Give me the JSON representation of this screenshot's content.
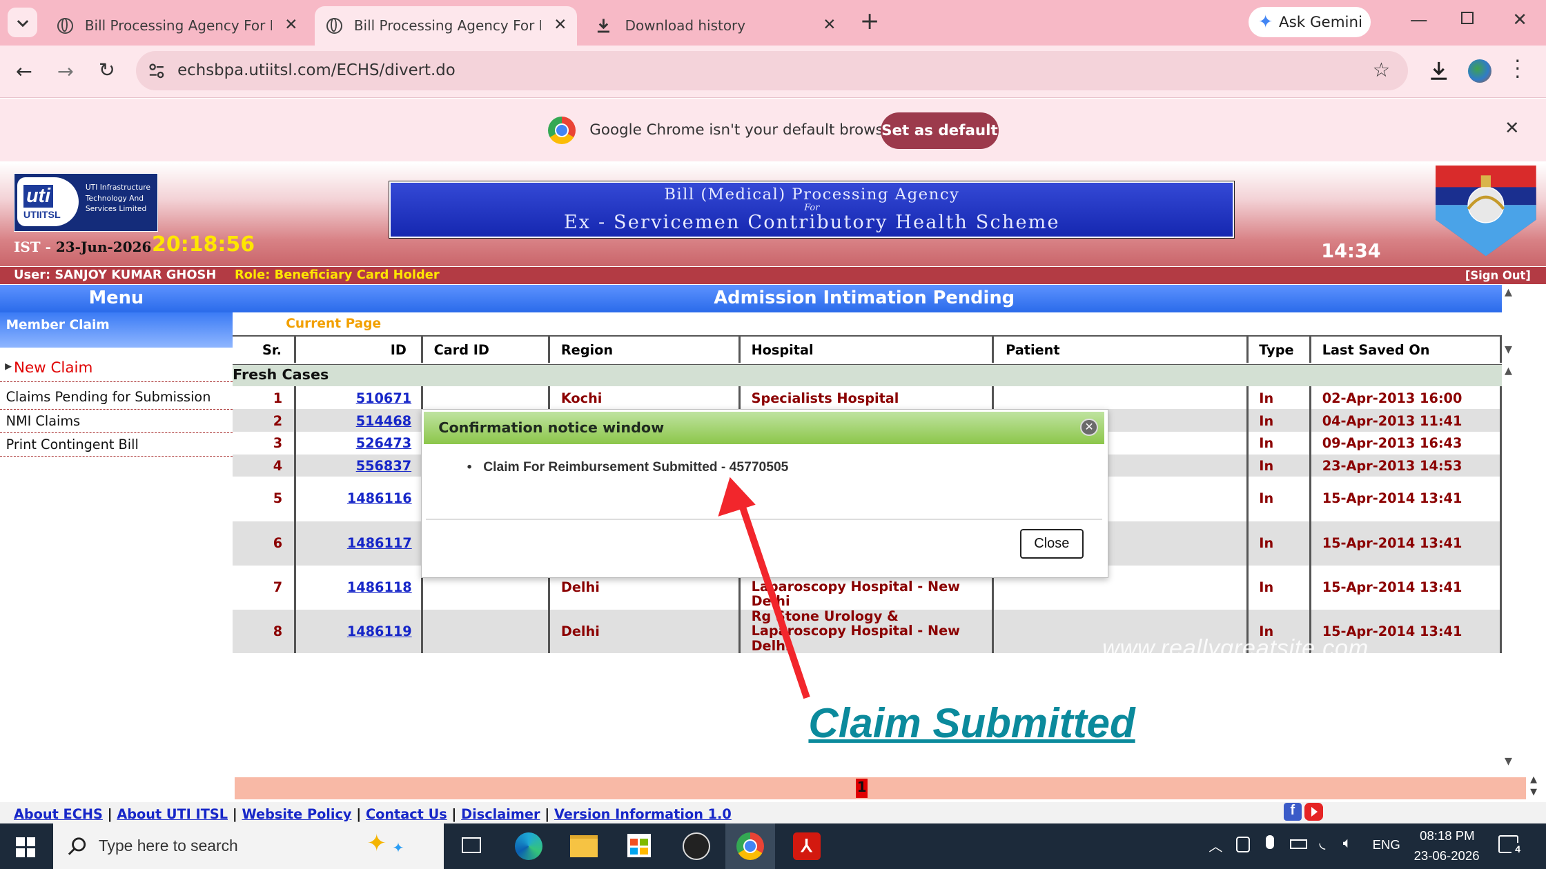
{
  "browser": {
    "tabs": [
      {
        "title": "Bill Processing Agency For ECHS",
        "active": false
      },
      {
        "title": "Bill Processing Agency For ECHS",
        "active": true
      },
      {
        "title": "Download history",
        "active": false
      }
    ],
    "new_tab_symbol": "+",
    "ask_gemini": "Ask Gemini",
    "url": "echsbpa.utiitsl.com/ECHS/divert.do"
  },
  "infobar": {
    "message": "Google Chrome isn't your default browser",
    "button": "Set as default"
  },
  "header": {
    "logo_text": "uti",
    "logo_sub": "UTIITSL",
    "logo_tag": [
      "UTI Infrastructure",
      "Technology And",
      "Services Limited"
    ],
    "ist_label": "IST",
    "date": "23-Jun-2026",
    "time": "20:18:56",
    "banner_line1": "Bill (Medical) Processing Agency",
    "banner_line2": "For",
    "banner_line3": "Ex - Servicemen Contributory Health Scheme",
    "session_time": "14:34",
    "user_label": "User:",
    "user_name": "SANJOY KUMAR GHOSH",
    "role_label": "Role:",
    "role_value": "Beneficiary Card Holder",
    "sign_out": "[Sign Out]"
  },
  "sidebar": {
    "menu_title": "Menu",
    "section": "Member Claim",
    "items": [
      "New Claim",
      "Claims Pending for Submission",
      "NMI Claims",
      "Print Contingent Bill"
    ]
  },
  "main": {
    "title": "Admission Intimation Pending",
    "current_page": "Current Page",
    "columns": [
      "Sr.",
      "ID",
      "Card ID",
      "Region",
      "Hospital",
      "Patient",
      "Type",
      "Last Saved On"
    ],
    "group": "Fresh Cases",
    "rows": [
      {
        "sr": "1",
        "id": "510671",
        "card": "",
        "region": "Kochi",
        "hospital": "Specialists Hospital",
        "patient": "",
        "type": "In",
        "saved": "02-Apr-2013 16:00"
      },
      {
        "sr": "2",
        "id": "514468",
        "card": "",
        "region": "",
        "hospital": "",
        "patient": "",
        "type": "In",
        "saved": "04-Apr-2013 11:41"
      },
      {
        "sr": "3",
        "id": "526473",
        "card": "",
        "region": "",
        "hospital": "",
        "patient": "",
        "type": "In",
        "saved": "09-Apr-2013 16:43"
      },
      {
        "sr": "4",
        "id": "556837",
        "card": "",
        "region": "",
        "hospital": "",
        "patient": "",
        "type": "In",
        "saved": "23-Apr-2013 14:53"
      },
      {
        "sr": "5",
        "id": "1486116",
        "card": "",
        "region": "",
        "hospital": "",
        "patient": "",
        "type": "In",
        "saved": "15-Apr-2014 13:41"
      },
      {
        "sr": "6",
        "id": "1486117",
        "card": "",
        "region": "",
        "hospital": "",
        "patient": "",
        "type": "In",
        "saved": "15-Apr-2014 13:41"
      },
      {
        "sr": "7",
        "id": "1486118",
        "card": "",
        "region": "Delhi",
        "hospital": "Laparoscopy Hospital - New Delhi",
        "patient": "",
        "type": "In",
        "saved": "15-Apr-2014 13:41"
      },
      {
        "sr": "8",
        "id": "1486119",
        "card": "",
        "region": "Delhi",
        "hospital": "Rg Stone Urology & Laparoscopy Hospital - New Delhi",
        "patient": "",
        "type": "In",
        "saved": "15-Apr-2014 13:41"
      }
    ],
    "page_number": "1"
  },
  "dialog": {
    "title": "Confirmation notice window",
    "message": "Claim For Reimbursement Submitted - 45770505",
    "close_button": "Close"
  },
  "annotation": {
    "label": "Claim Submitted",
    "watermark": "www.reallygreatsite.com"
  },
  "footer": {
    "links": [
      "About ECHS",
      "About UTI ITSL",
      "Website Policy",
      "Contact Us",
      "Disclaimer",
      "Version Information 1.0"
    ]
  },
  "taskbar": {
    "search_placeholder": "Type here to search",
    "language": "ENG",
    "time": "08:18 PM",
    "date": "23-06-2026",
    "notification_count": "4"
  },
  "colors": {
    "menu_blue": "#2f6ff0",
    "header_red": "#b33b44",
    "date_yellow": "#ffe600",
    "claim_red": "#e00000",
    "saved_red": "#8b0000",
    "annotation_teal": "#0b8a9c"
  }
}
